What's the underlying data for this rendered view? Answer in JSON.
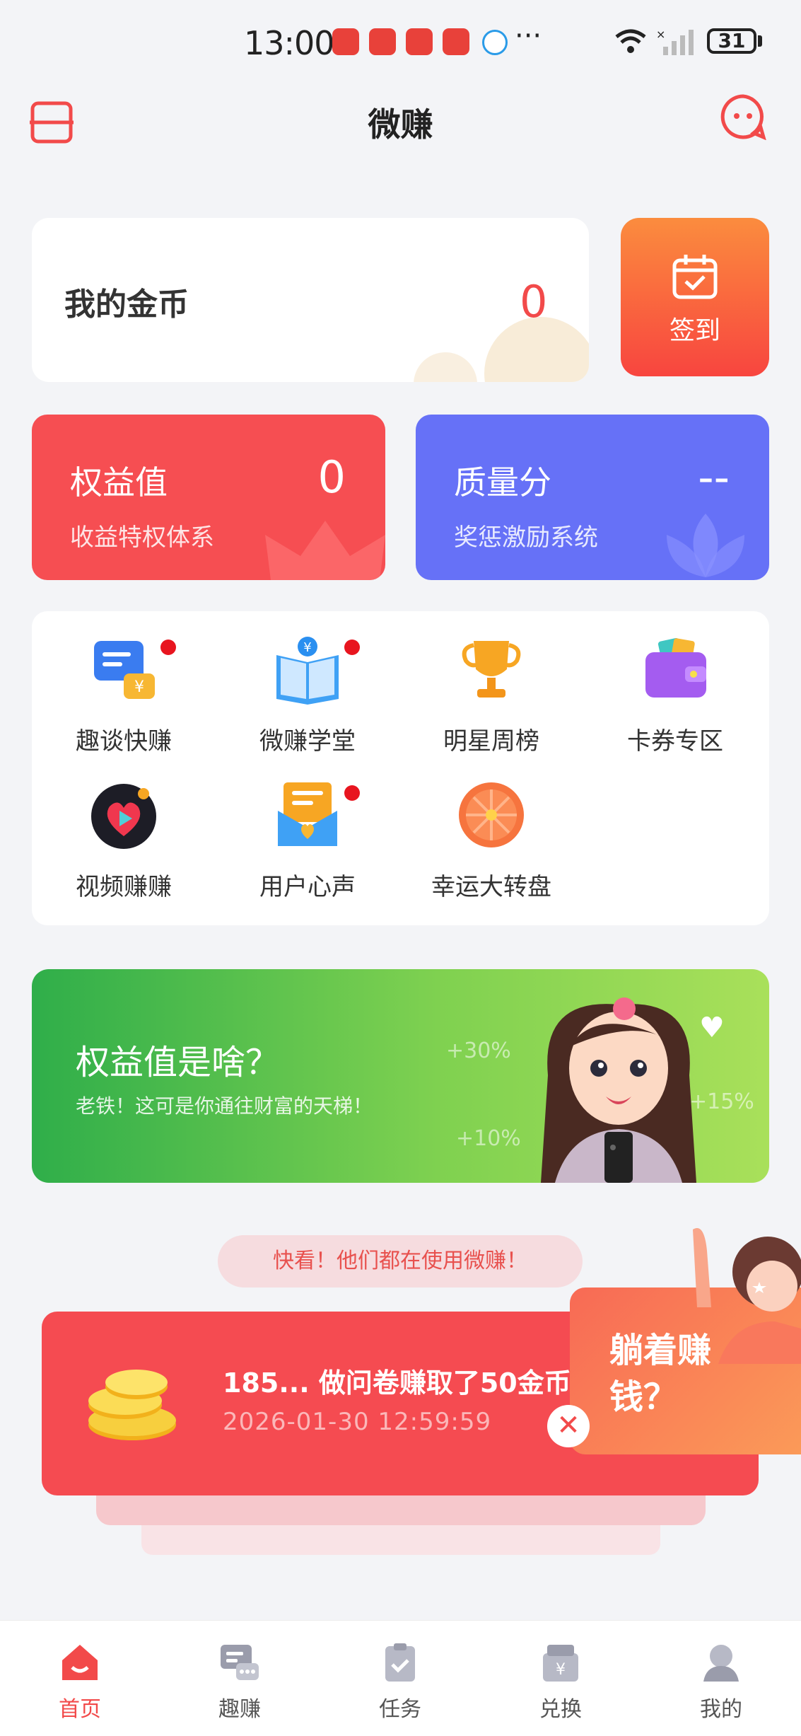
{
  "status_bar": {
    "time": "13:00",
    "battery": "31",
    "more": "···"
  },
  "header": {
    "title": "微赚"
  },
  "coins": {
    "label": "我的金币",
    "value": "0"
  },
  "checkin": {
    "label": "签到"
  },
  "rights": {
    "title": "权益值",
    "subtitle": "收益特权体系",
    "value": "0"
  },
  "quality": {
    "title": "质量分",
    "subtitle": "奖惩激励系统",
    "value": "--"
  },
  "grid": {
    "items": [
      {
        "label": "趣谈快赚",
        "icon": "chat-coin-icon",
        "badge": true
      },
      {
        "label": "微赚学堂",
        "icon": "book-icon",
        "badge": true
      },
      {
        "label": "明星周榜",
        "icon": "trophy-icon",
        "badge": false
      },
      {
        "label": "卡券专区",
        "icon": "wallet-icon",
        "badge": false
      },
      {
        "label": "视频赚赚",
        "icon": "video-icon",
        "badge": false
      },
      {
        "label": "用户心声",
        "icon": "mailbox-icon",
        "badge": true
      },
      {
        "label": "幸运大转盘",
        "icon": "wheel-icon",
        "badge": false
      }
    ]
  },
  "banner": {
    "title": "权益值是啥？",
    "subtitle": "老铁！这可是你通往财富的天梯！",
    "pct1": "+30%",
    "pct2": "+15%",
    "pct3": "+10%"
  },
  "activity": {
    "pill": "快看！他们都在使用微赚！",
    "text": "185... 做问卷赚取了50金币",
    "time": "2026-01-30 12:59:59"
  },
  "promo": {
    "text": "躺着赚钱？"
  },
  "tabs": [
    {
      "label": "首页",
      "icon": "home-icon",
      "active": true
    },
    {
      "label": "趣赚",
      "icon": "chat-icon",
      "active": false
    },
    {
      "label": "任务",
      "icon": "task-icon",
      "active": false
    },
    {
      "label": "兑换",
      "icon": "exchange-icon",
      "active": false
    },
    {
      "label": "我的",
      "icon": "profile-icon",
      "active": false
    }
  ],
  "colors": {
    "accent": "#f24a4a",
    "quality": "#6671f7",
    "banner": "#2fae4a"
  }
}
